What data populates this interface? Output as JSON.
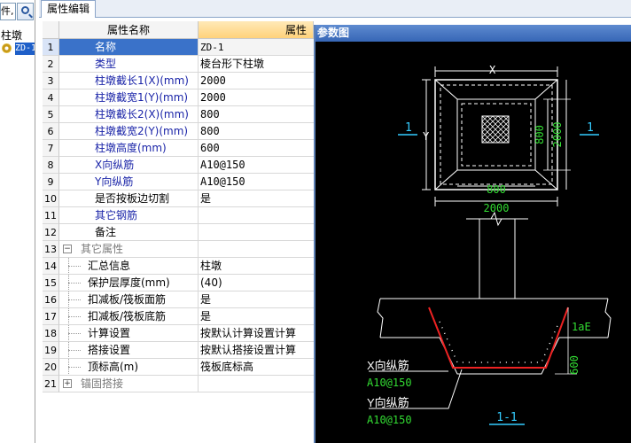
{
  "left_panel": {
    "search_text": "件,",
    "category": "柱墩",
    "item": "ZD-1"
  },
  "tabs": [
    {
      "label": "属性编辑"
    }
  ],
  "grid": {
    "headers": {
      "name": "属性名称",
      "value": "属性"
    },
    "rows": [
      {
        "num": "1",
        "name": "名称",
        "value": "ZD-1"
      },
      {
        "num": "2",
        "name": "类型",
        "value": "棱台形下柱墩"
      },
      {
        "num": "3",
        "name": "柱墩截长1(X)(mm)",
        "value": "2000"
      },
      {
        "num": "4",
        "name": "柱墩截宽1(Y)(mm)",
        "value": "2000"
      },
      {
        "num": "5",
        "name": "柱墩截长2(X)(mm)",
        "value": "800"
      },
      {
        "num": "6",
        "name": "柱墩截宽2(Y)(mm)",
        "value": "800"
      },
      {
        "num": "7",
        "name": "柱墩高度(mm)",
        "value": "600"
      },
      {
        "num": "8",
        "name": "X向纵筋",
        "value": "A10@150"
      },
      {
        "num": "9",
        "name": "Y向纵筋",
        "value": "A10@150"
      },
      {
        "num": "10",
        "name": "是否按板边切割",
        "value": "是"
      },
      {
        "num": "11",
        "name": "其它钢筋",
        "value": ""
      },
      {
        "num": "12",
        "name": "备注",
        "value": ""
      },
      {
        "num": "13",
        "name": "其它属性",
        "value": "",
        "expander": "−"
      },
      {
        "num": "14",
        "name": "汇总信息",
        "value": "柱墩"
      },
      {
        "num": "15",
        "name": "保护层厚度(mm)",
        "value": "(40)"
      },
      {
        "num": "16",
        "name": "扣减板/筏板面筋",
        "value": "是"
      },
      {
        "num": "17",
        "name": "扣减板/筏板底筋",
        "value": "是"
      },
      {
        "num": "18",
        "name": "计算设置",
        "value": "按默认计算设置计算"
      },
      {
        "num": "19",
        "name": "搭接设置",
        "value": "按默认搭接设置计算"
      },
      {
        "num": "20",
        "name": "顶标高(m)",
        "value": "筏板底标高"
      },
      {
        "num": "21",
        "name": "锚固搭接",
        "value": "",
        "expander": "+"
      }
    ]
  },
  "figure": {
    "title": "参数图",
    "labels": {
      "x": "X",
      "y": "Y",
      "dim_800_v": "800",
      "dim_2000_v": "2000",
      "dim_800_h": "800",
      "dim_2000_h": "2000",
      "section_mark_left": "1",
      "section_mark_right": "1",
      "lae": "1aE",
      "dim_600": "600",
      "x_bar_label": "X向纵筋",
      "x_bar_spec": "A10@150",
      "y_bar_label": "Y向纵筋",
      "y_bar_spec": "A10@150",
      "section_title": "1-1"
    },
    "colors": {
      "white": "#ffffff",
      "green": "#33dd33",
      "cyan": "#33ccff",
      "red": "#ee2222"
    }
  }
}
